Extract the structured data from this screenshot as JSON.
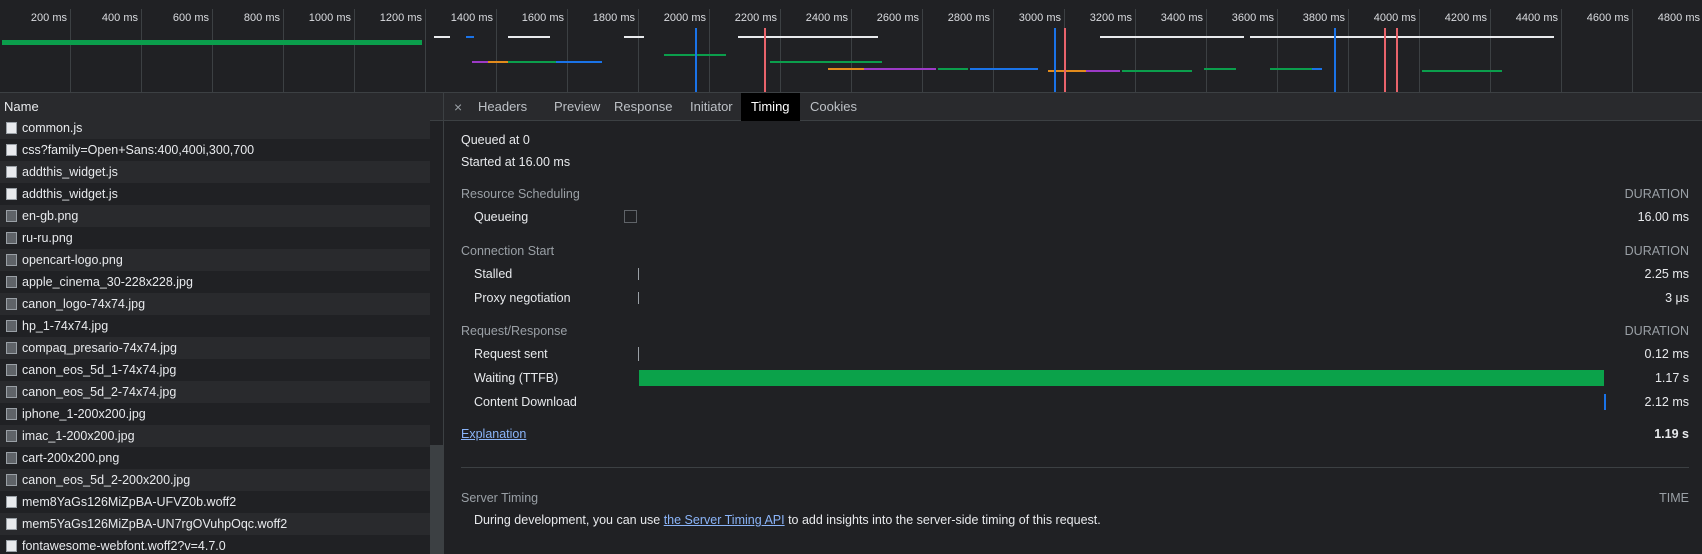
{
  "overview": {
    "ticks": [
      "200 ms",
      "400 ms",
      "600 ms",
      "800 ms",
      "1000 ms",
      "1200 ms",
      "1400 ms",
      "1600 ms",
      "1800 ms",
      "2000 ms",
      "2200 ms",
      "2400 ms",
      "2600 ms",
      "2800 ms",
      "3000 ms",
      "3200 ms",
      "3400 ms",
      "3600 ms",
      "3800 ms",
      "4000 ms",
      "4200 ms",
      "4400 ms",
      "4600 ms",
      "4800 ms"
    ],
    "colors": {
      "waiting": "#0b9e4c",
      "script": "#e28b1c",
      "image": "#9c3ac6",
      "html": "#1a73e8",
      "other": "#e8eaed"
    }
  },
  "list": {
    "header": "Name",
    "items": [
      {
        "name": "common.js",
        "icon": "file-icon"
      },
      {
        "name": "css?family=Open+Sans:400,400i,300,700",
        "icon": "file-icon"
      },
      {
        "name": "addthis_widget.js",
        "icon": "file-icon"
      },
      {
        "name": "addthis_widget.js",
        "icon": "file-icon"
      },
      {
        "name": "en-gb.png",
        "icon": "image-icon"
      },
      {
        "name": "ru-ru.png",
        "icon": "image-icon"
      },
      {
        "name": "opencart-logo.png",
        "icon": "image-icon"
      },
      {
        "name": "apple_cinema_30-228x228.jpg",
        "icon": "image-icon"
      },
      {
        "name": "canon_logo-74x74.jpg",
        "icon": "image-icon"
      },
      {
        "name": "hp_1-74x74.jpg",
        "icon": "image-icon"
      },
      {
        "name": "compaq_presario-74x74.jpg",
        "icon": "image-icon"
      },
      {
        "name": "canon_eos_5d_1-74x74.jpg",
        "icon": "image-icon"
      },
      {
        "name": "canon_eos_5d_2-74x74.jpg",
        "icon": "image-icon"
      },
      {
        "name": "iphone_1-200x200.jpg",
        "icon": "image-icon"
      },
      {
        "name": "imac_1-200x200.jpg",
        "icon": "image-icon"
      },
      {
        "name": "cart-200x200.png",
        "icon": "image-icon"
      },
      {
        "name": "canon_eos_5d_2-200x200.jpg",
        "icon": "image-icon"
      },
      {
        "name": "mem8YaGs126MiZpBA-UFVZ0b.woff2",
        "icon": "file-icon"
      },
      {
        "name": "mem5YaGs126MiZpBA-UN7rgOVuhpOqc.woff2",
        "icon": "file-icon"
      },
      {
        "name": "fontawesome-webfont.woff2?v=4.7.0",
        "icon": "file-icon"
      }
    ]
  },
  "tabs": {
    "close": "×",
    "items": [
      "Headers",
      "Preview",
      "Response",
      "Initiator",
      "Timing",
      "Cookies"
    ],
    "active": "Timing"
  },
  "timing": {
    "queued": "Queued at 0",
    "started": "Started at 16.00 ms",
    "sections": {
      "scheduling": "Resource Scheduling",
      "connection": "Connection Start",
      "request": "Request/Response",
      "duration_header": "DURATION"
    },
    "rows": {
      "queueing": {
        "label": "Queueing",
        "value": "16.00 ms"
      },
      "stalled": {
        "label": "Stalled",
        "value": "2.25 ms"
      },
      "proxy": {
        "label": "Proxy negotiation",
        "value": "3 μs"
      },
      "request_sent": {
        "label": "Request sent",
        "value": "0.12 ms"
      },
      "waiting": {
        "label": "Waiting (TTFB)",
        "value": "1.17 s"
      },
      "download": {
        "label": "Content Download",
        "value": "2.12 ms"
      }
    },
    "explanation": "Explanation",
    "total": "1.19 s",
    "server_timing": {
      "title": "Server Timing",
      "time_header": "TIME",
      "text_before": "During development, you can use ",
      "link": "the Server Timing API",
      "text_after": " to add insights into the server-side timing of this request."
    }
  }
}
